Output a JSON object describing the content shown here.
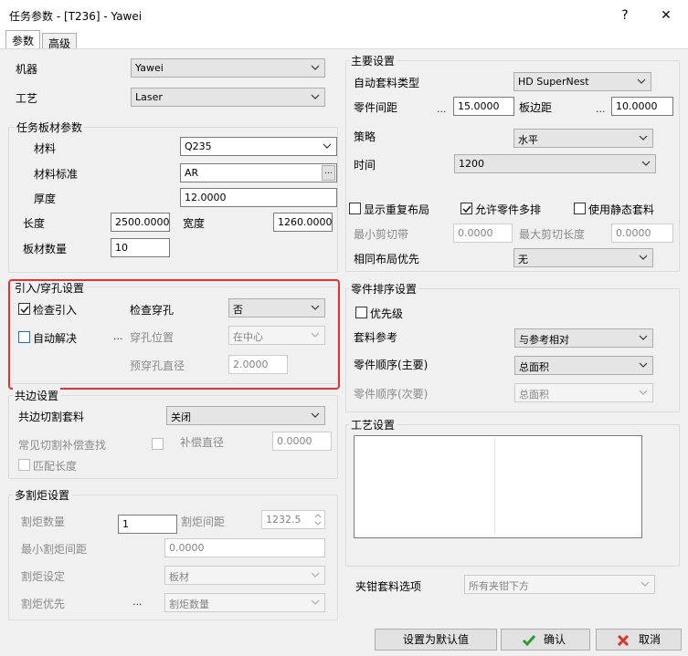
{
  "window": {
    "title": "任务参数 - [T236] - Yawei",
    "help": "?",
    "close": "✕"
  },
  "tabs": [
    {
      "label": "参数"
    },
    {
      "label": "高级"
    }
  ],
  "left": {
    "machine_label": "机器",
    "machine_value": "Yawei",
    "process_label": "工艺",
    "process_value": "Laser",
    "sheet_group": {
      "title": "任务板材参数",
      "material_label": "材料",
      "material_value": "Q235",
      "standard_label": "材料标准",
      "standard_value": "AR",
      "standard_btn": "...",
      "thickness_label": "厚度",
      "thickness_value": "12.0000",
      "length_label": "长度",
      "length_value": "2500.0000",
      "width_label": "宽度",
      "width_value": "1260.0000",
      "count_label": "板材数量",
      "count_value": "10"
    },
    "leadin_group": {
      "title": "引入/穿孔设置",
      "check_leadin": "检查引入",
      "check_pierce_label": "检查穿孔",
      "check_pierce_value": "否",
      "auto_resolve": "自动解决",
      "auto_dots": "...",
      "pierce_pos_label": "穿孔位置",
      "pierce_pos_value": "在中心",
      "prepierce_label": "预穿孔直径",
      "prepierce_value": "2.0000"
    },
    "common_group": {
      "title": "共边设置",
      "cut_label": "共边切割套料",
      "cut_value": "关闭",
      "comp_search_label": "常见切割补偿查找",
      "comp_dia_label": "补偿直径",
      "comp_dia_value": "0.0000",
      "match_length": "匹配长度"
    },
    "torch_group": {
      "title": "多割炬设置",
      "count_label": "割炬数量",
      "count_value": "1",
      "spacing_label": "割炬间距",
      "spacing_value": "1232.5",
      "min_spacing_label": "最小割炬间距",
      "min_spacing_value": "0.0000",
      "setting_label": "割炬设定",
      "setting_value": "板材",
      "priority_label": "割炬优先",
      "priority_dots": "...",
      "priority_value": "割炬数量"
    }
  },
  "right": {
    "main_group": {
      "title": "主要设置",
      "auto_type_label": "自动套料类型",
      "auto_type_value": "HD SuperNest",
      "part_gap_label": "零件间距",
      "part_gap_dots": "...",
      "part_gap_value": "15.0000",
      "edge_gap_label": "板边距",
      "edge_gap_dots": "...",
      "edge_gap_value": "10.0000",
      "strategy_label": "策略",
      "strategy_value": "水平",
      "time_label": "时间",
      "time_value": "1200",
      "show_repeat": "显示重复布局",
      "allow_multi": "允许零件多排",
      "use_static": "使用静态套料",
      "min_cut_label": "最小剪切带",
      "min_cut_value": "0.0000",
      "max_cut_label": "最大剪切长度",
      "max_cut_value": "0.0000",
      "same_layout_label": "相同布局优先",
      "same_layout_value": "无"
    },
    "order_group": {
      "title": "零件排序设置",
      "priority": "优先级",
      "nest_ref_label": "套料参考",
      "nest_ref_value": "与参考相对",
      "order_main_label": "零件顺序(主要)",
      "order_main_value": "总面积",
      "order_sec_label": "零件顺序(次要)",
      "order_sec_value": "总面积"
    },
    "process_group": {
      "title": "工艺设置"
    },
    "clamp_label": "夹钳套料选项",
    "clamp_value": "所有夹钳下方"
  },
  "footer": {
    "default_btn": "设置为默认值",
    "ok_btn": "确认",
    "cancel_btn": "取消"
  },
  "colors": {
    "highlight": "#e03434",
    "ok_check": "#2e9a35",
    "cancel_x": "#d9342b"
  }
}
